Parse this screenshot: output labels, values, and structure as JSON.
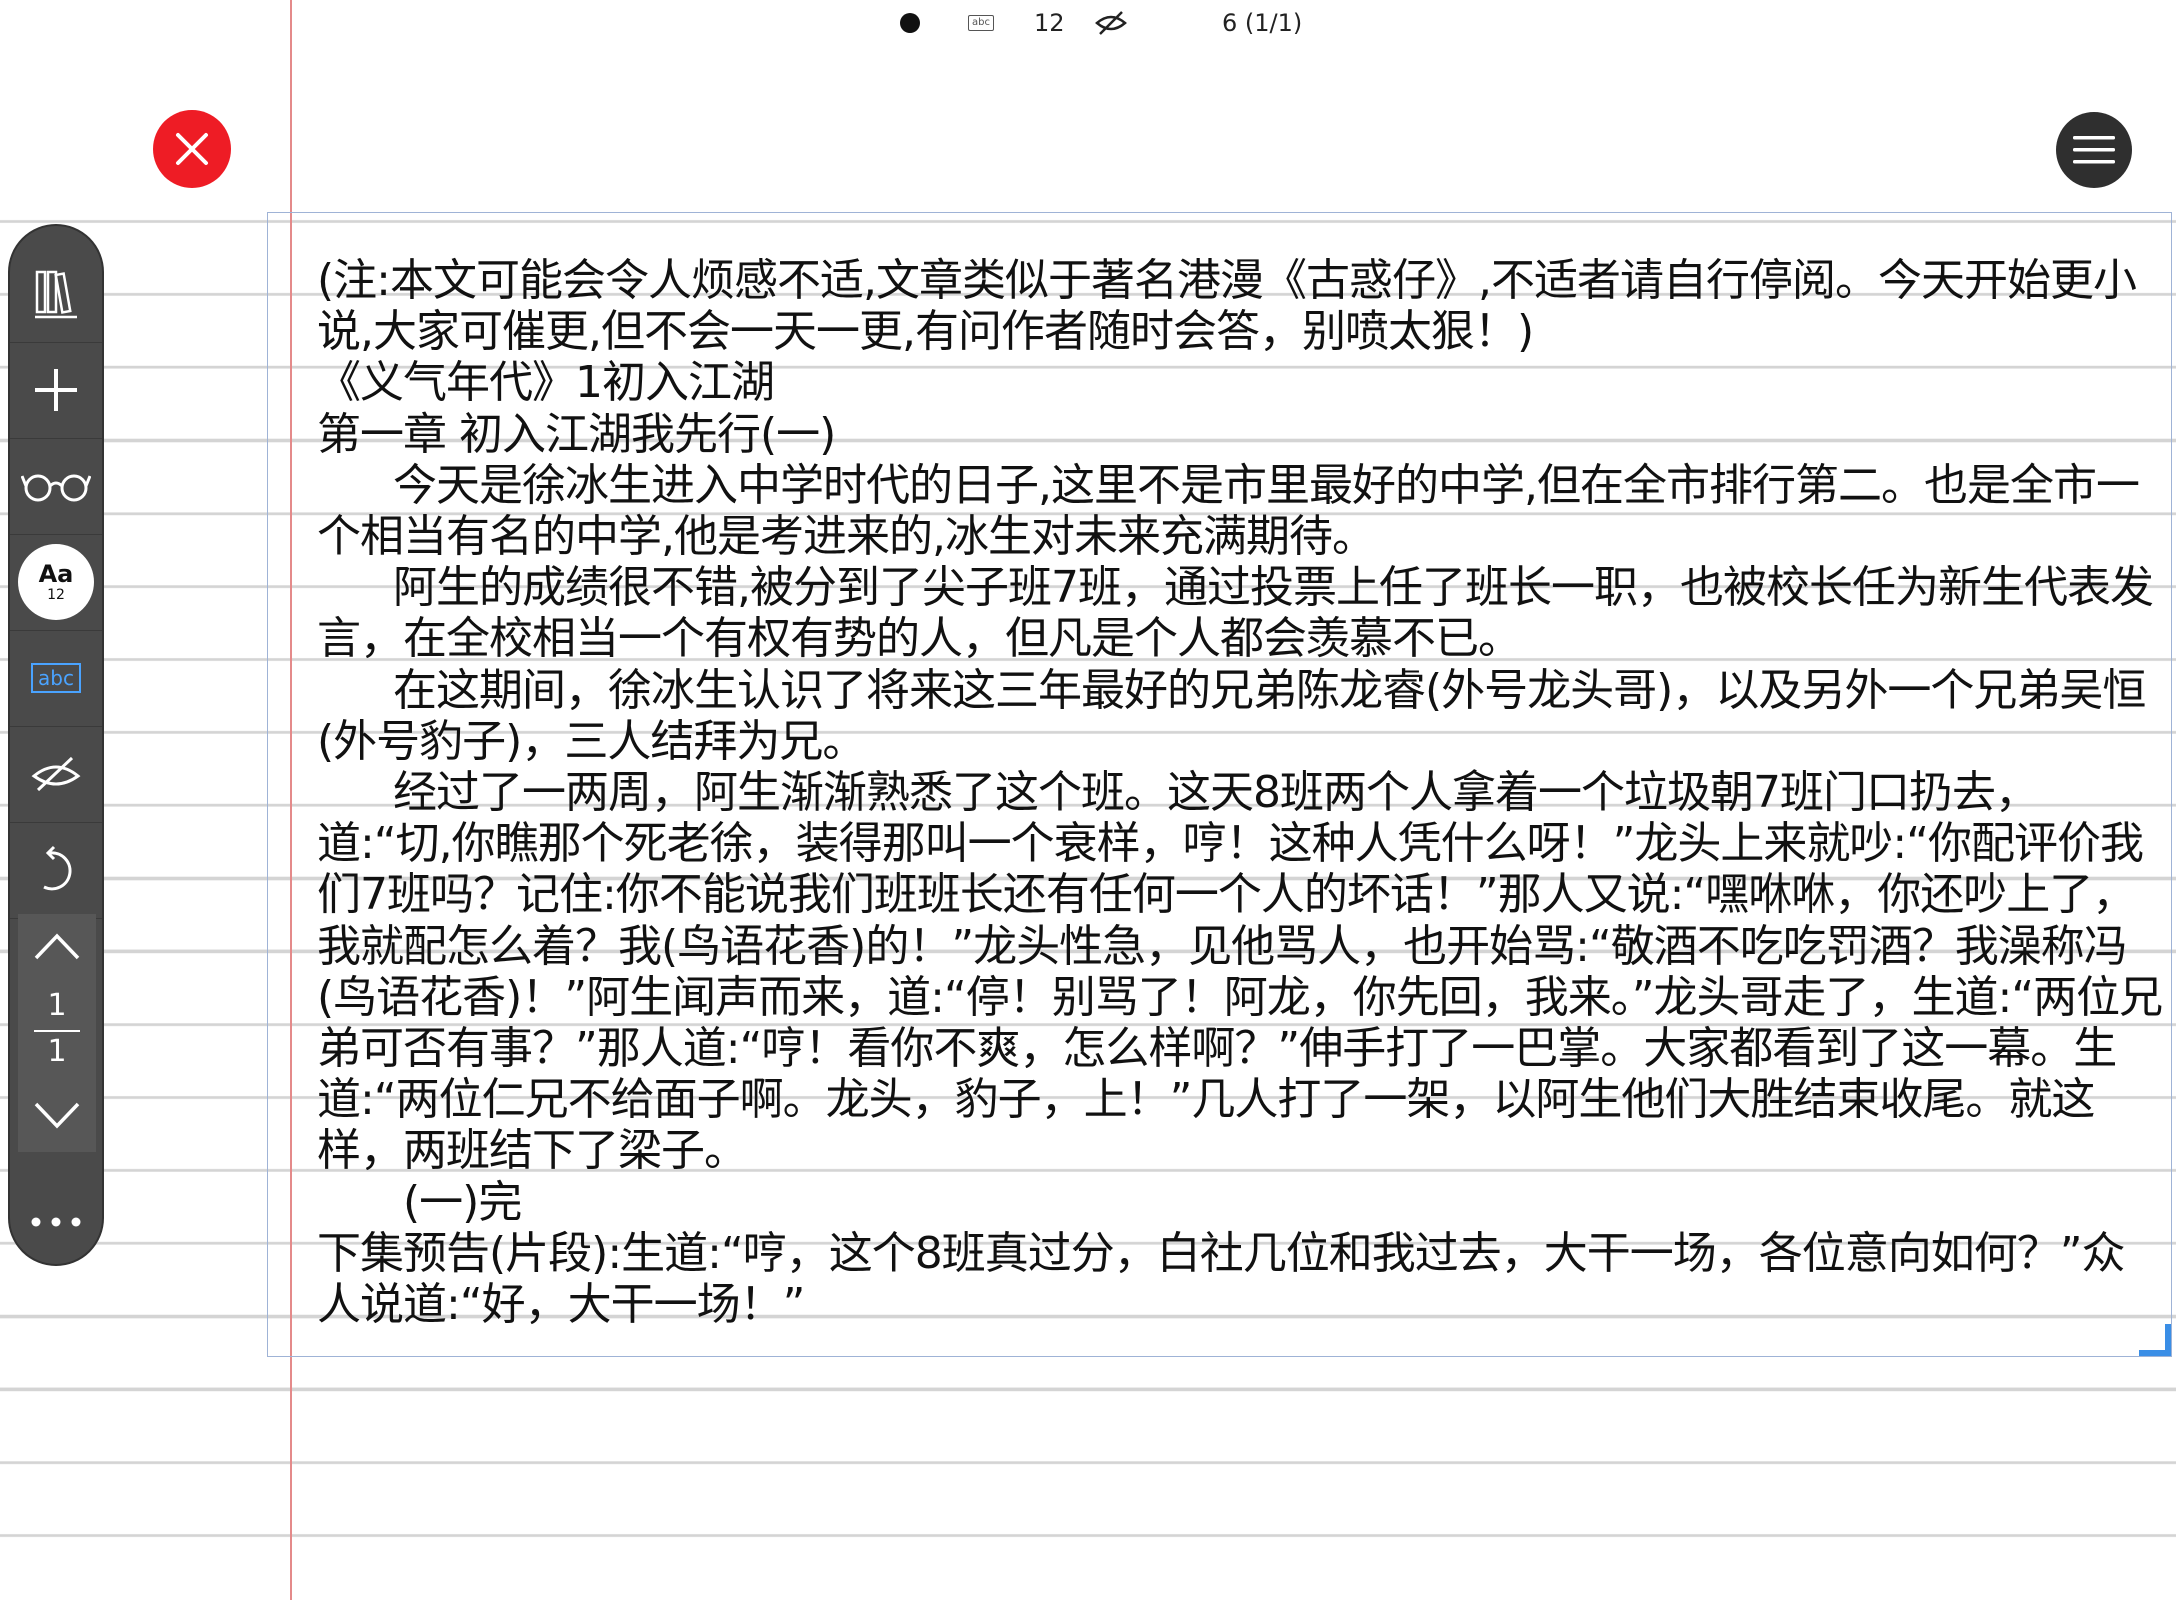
{
  "status_bar": {
    "font_size": "12",
    "page_indicator": "6 (1/1)"
  },
  "toolbar": {
    "font_button": {
      "label": "Aa",
      "size": "12"
    },
    "abc_label": "abc",
    "pager": {
      "current": "1",
      "total": "1"
    }
  },
  "icons": {
    "close": "close-icon",
    "menu": "hamburger-menu-icon",
    "library": "library-icon",
    "add": "plus-icon",
    "read": "glasses-icon",
    "hide_handwriting": "eye-slash-pen-icon",
    "undo": "undo-icon",
    "page_up": "chevron-up-icon",
    "page_down": "chevron-down-icon",
    "more": "more-icon"
  },
  "colors": {
    "close": "#ee1c25",
    "menu": "#2f2f2f",
    "toolbar": "#4a4a4a",
    "accent": "#4aa3ff",
    "margin": "#e48a8a"
  },
  "document": {
    "paragraphs": [
      "(注:本文可能会令人烦感不适,文章类似于著名港漫《古惑仔》,不适者请自行停阅。今天开始更小说,大家可催更,但不会一天一更,有问作者随时会答，别喷太狠！)",
      "《义气年代》1初入江湖",
      "第一章 初入江湖我先行(一)",
      "今天是徐冰生进入中学时代的日子,这里不是市里最好的中学,但在全市排行第二。也是全市一个相当有名的中学,他是考进来的,冰生对未来充满期待。",
      "阿生的成绩很不错,被分到了尖子班7班，通过投票上任了班长一职，也被校长任为新生代表发言，在全校相当一个有权有势的人，但凡是个人都会羡慕不已。",
      "在这期间，徐冰生认识了将来这三年最好的兄弟陈龙睿(外号龙头哥)，以及另外一个兄弟吴恒(外号豹子)，三人结拜为兄。",
      "经过了一两周，阿生渐渐熟悉了这个班。这天8班两个人拿着一个垃圾朝7班门口扔去，道:“切,你瞧那个死老徐，装得那叫一个衰样，哼！这种人凭什么呀！”龙头上来就吵:“你配评价我们7班吗？记住:你不能说我们班班长还有任何一个人的坏话！”那人又说:“嘿咻咻，你还吵上了，我就配怎么着？我(鸟语花香)的！”龙头性急，见他骂人，也开始骂:“敬酒不吃吃罚酒？我澡称冯(鸟语花香)！”阿生闻声而来，道:“停！别骂了！阿龙，你先回，我来。”龙头哥走了，生道:“两位兄弟可否有事？”那人道:“哼！看你不爽，怎么样啊？”伸手打了一巴掌。大家都看到了这一幕。生道:“两位仁兄不给面子啊。龙头，豹子，上！”几人打了一架，以阿生他们大胜结束收尾。就这样，两班结下了梁子。",
      "(一)完",
      "下集预告(片段):生道:“哼，这个8班真过分，白社几位和我过去，大干一场，各位意向如何？”众人说道:“好，大干一场！”"
    ]
  }
}
